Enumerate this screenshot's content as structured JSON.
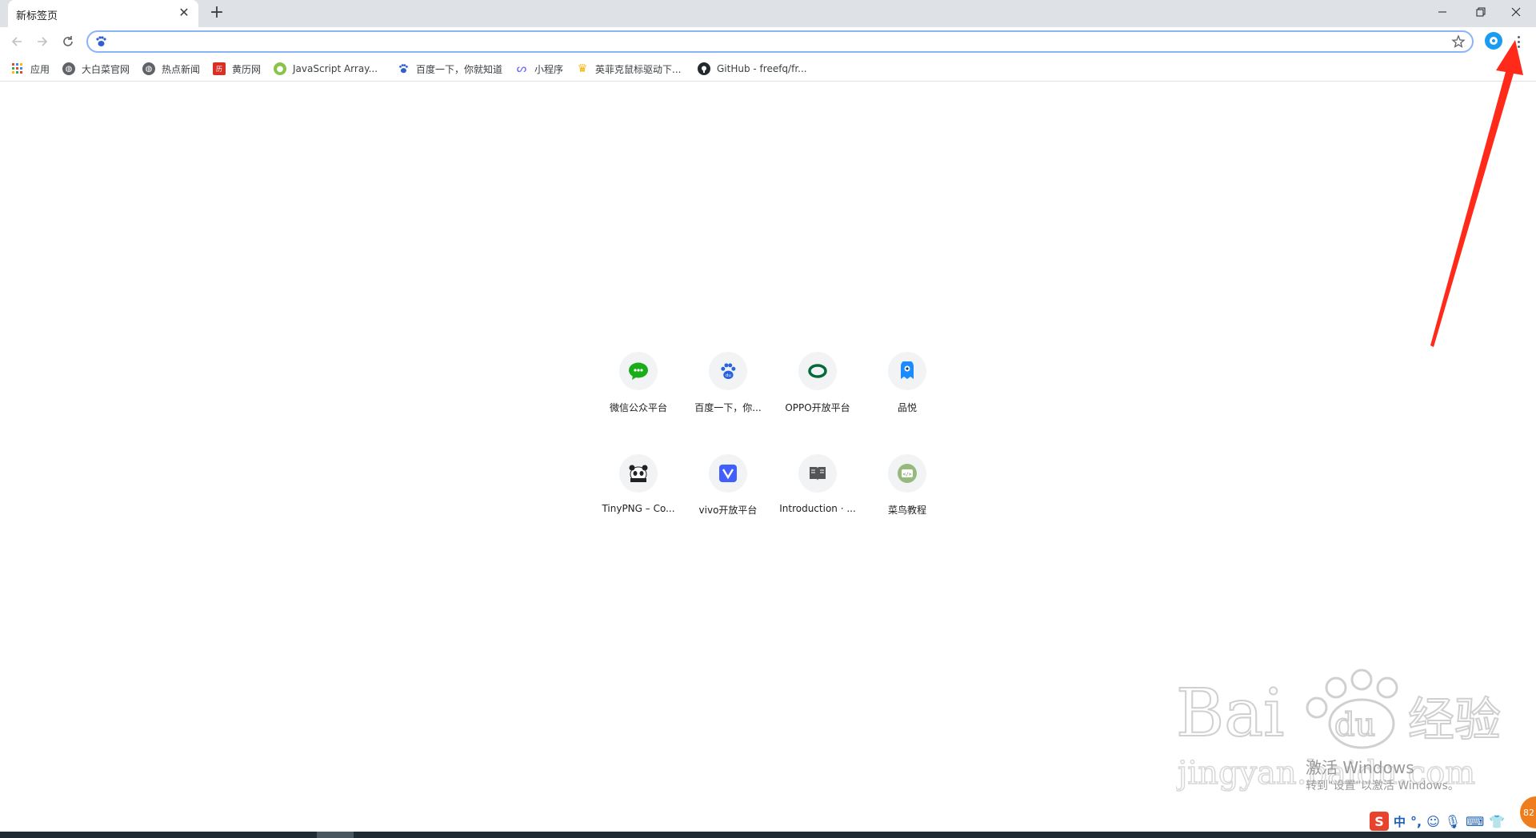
{
  "tab": {
    "title": "新标签页",
    "close": "✕"
  },
  "newtab": "+",
  "window": {
    "minimize": "—",
    "restore": "❐",
    "close": "✕"
  },
  "omnibox": {
    "value": "",
    "placeholder": ""
  },
  "bookmarks": [
    {
      "label": "应用",
      "icon": "apps-grid-icon"
    },
    {
      "label": "大白菜官网",
      "icon": "globe-icon"
    },
    {
      "label": "热点新闻",
      "icon": "globe-icon"
    },
    {
      "label": "黄历网",
      "icon": "calendar-icon"
    },
    {
      "label": "JavaScript Array...",
      "icon": "site-icon"
    },
    {
      "label": "百度一下，你就知道",
      "icon": "baidu-paw-icon"
    },
    {
      "label": "小程序",
      "icon": "miniprogram-icon"
    },
    {
      "label": "英菲克鼠标驱动下...",
      "icon": "trophy-icon"
    },
    {
      "label": "GitHub - freefq/fr...",
      "icon": "github-icon"
    }
  ],
  "shortcuts": [
    {
      "label": "微信公众平台",
      "icon": "wechat-icon"
    },
    {
      "label": "百度一下，你...",
      "icon": "baidu-paw-icon"
    },
    {
      "label": "OPPO开放平台",
      "icon": "oppo-icon"
    },
    {
      "label": "品悦",
      "icon": "pinyue-icon"
    },
    {
      "label": "TinyPNG – Co...",
      "icon": "tinypng-panda-icon"
    },
    {
      "label": "vivo开放平台",
      "icon": "vivo-icon"
    },
    {
      "label": "Introduction · ...",
      "icon": "book-icon"
    },
    {
      "label": "菜鸟教程",
      "icon": "runoob-icon"
    }
  ],
  "watermark": {
    "brand": "Bai du 经验",
    "url": "jingyan.baidu.com"
  },
  "activate_windows": {
    "title": "激活 Windows",
    "subtitle": "转到\"设置\"以激活 Windows。"
  },
  "ime": {
    "logo": "S",
    "lang": "中"
  },
  "badge": "82"
}
